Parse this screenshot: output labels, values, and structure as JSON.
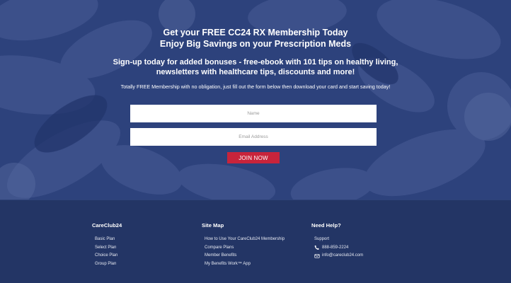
{
  "hero": {
    "headline_line1": "Get your FREE CC24 RX Membership Today",
    "headline_line2": "Enjoy Big Savings on your Prescription Meds",
    "subhead_line1": "Sign-up today for added bonuses - free-ebook with 101 tips on healthy living,",
    "subhead_line2": "newsletters with healthcare tips, discounts and more!",
    "tagline": "Totally FREE Membership with no obligation, just fill out the form below then download your card and start saving today!"
  },
  "form": {
    "name_placeholder": "Name",
    "name_value": "",
    "email_placeholder": "Email Address",
    "email_value": "",
    "submit_label": "JOIN NOW"
  },
  "footer": {
    "col1": {
      "title": "CareClub24",
      "items": [
        "Basic Plan",
        "Select Plan",
        "Choice Plan",
        "Group Plan"
      ]
    },
    "col2": {
      "title": "Site Map",
      "items": [
        "How to Use Your CareClub24 Membership",
        "Compare Plans",
        "Member Benefits",
        "My Benefits Work™ App"
      ]
    },
    "col3": {
      "title": "Need Help?",
      "support": "Support",
      "phone": "888-859-2224",
      "phone_icon": "phone-icon",
      "email": "info@careclub24.com",
      "email_icon": "envelope-icon"
    }
  },
  "colors": {
    "hero_overlay": "#20346e",
    "footer_bg": "#233565",
    "button": "#c8243b"
  }
}
